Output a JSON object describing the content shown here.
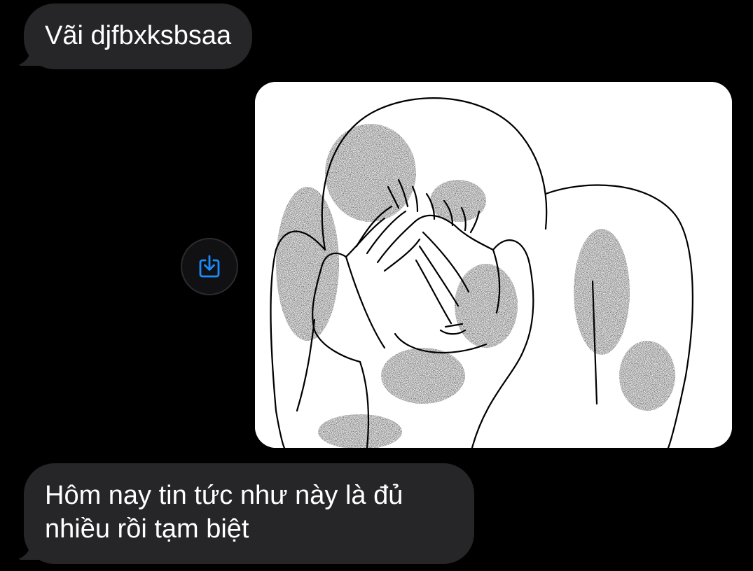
{
  "messages": [
    {
      "type": "text",
      "text": "Vãi djfbxksbsaa"
    },
    {
      "type": "image",
      "image_icon": "crying-facepalm-meme-drawing"
    },
    {
      "type": "text",
      "text": "Hôm nay tin tức như này là đủ nhiều rồi tạm biệt"
    }
  ],
  "save_action": {
    "icon": "save-download-icon",
    "accent_color": "#1a8cff"
  },
  "colors": {
    "background": "#000000",
    "received_bubble": "#262628",
    "text": "#ffffff"
  }
}
